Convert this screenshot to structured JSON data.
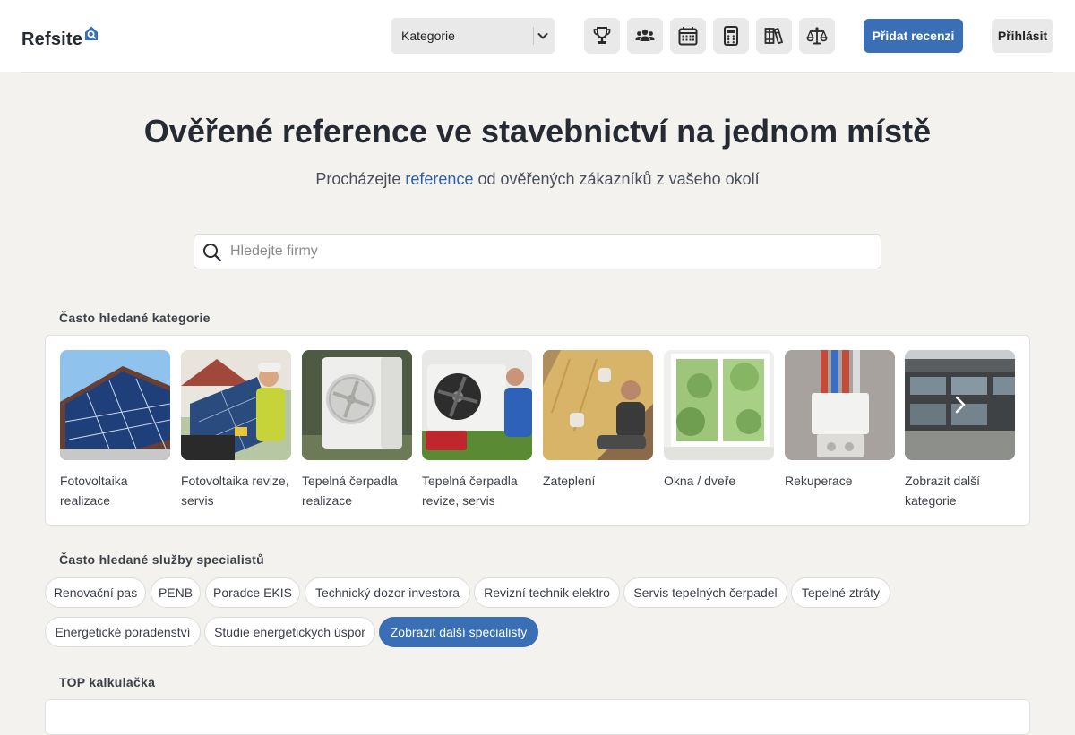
{
  "header": {
    "logo_text": "Refsite",
    "category_select": "Kategorie",
    "icons": [
      "trophy-icon",
      "users-icon",
      "calendar-icon",
      "calculator-icon",
      "books-icon",
      "scales-icon"
    ],
    "add_review": "Přidat recenzi",
    "login": "Přihlásit"
  },
  "hero": {
    "title": "Ověřené reference ve stavebnictví na jednom místě",
    "sub_before": "Procházejte ",
    "sub_link": "reference",
    "sub_after": " od ověřených zákazníků z vašeho okolí"
  },
  "search": {
    "placeholder": "Hledejte firmy"
  },
  "categories": {
    "title": "Často hledané kategorie",
    "items": [
      {
        "label": "Fotovoltaika realizace"
      },
      {
        "label": "Fotovoltaika revize, servis"
      },
      {
        "label": "Tepelná čerpadla realizace"
      },
      {
        "label": "Tepelná čerpadla revize, servis"
      },
      {
        "label": "Zateplení"
      },
      {
        "label": "Okna / dveře"
      },
      {
        "label": "Rekuperace"
      },
      {
        "label": "Zobrazit další kategorie"
      }
    ]
  },
  "specialists": {
    "title": "Často hledané služby specialistů",
    "chips": [
      "Renovační pas",
      "PENB",
      "Poradce EKIS",
      "Technický dozor investora",
      "Revizní technik elektro",
      "Servis tepelných čerpadel",
      "Tepelné ztráty",
      "Energetické poradenství",
      "Studie energetických úspor",
      "Zobrazit další specialisty"
    ]
  },
  "calculator": {
    "title": "TOP kalkulačka"
  },
  "colors": {
    "accent": "#3a6eb5",
    "background": "#f3f2ef",
    "text_dark": "#262a33"
  }
}
